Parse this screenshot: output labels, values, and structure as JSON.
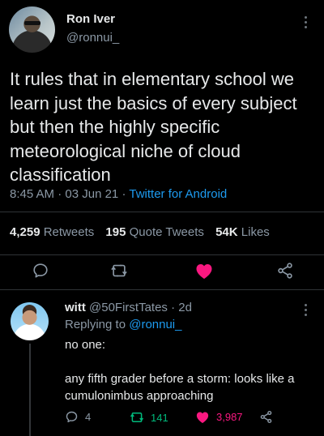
{
  "main_tweet": {
    "display_name": "Ron Iver",
    "handle": "@ronnui_",
    "text": "It rules that in elementary school we learn just the basics of every subject but then the highly specific meteorological niche of cloud classification",
    "time": "8:45 AM",
    "date": "03 Jun 21",
    "client": "Twitter for Android",
    "stats": {
      "retweets_count": "4,259",
      "retweets_label": "Retweets",
      "quotes_count": "195",
      "quotes_label": "Quote Tweets",
      "likes_count": "54K",
      "likes_label": "Likes"
    },
    "actions": [
      "reply",
      "retweet",
      "like",
      "share"
    ],
    "liked": true
  },
  "reply": {
    "display_name": "witt",
    "handle": "@50FirstTates",
    "age": "2d",
    "replying_prefix": "Replying to",
    "replying_to": "@ronnui_",
    "line1": "no one:",
    "line2": "any fifth grader before a storm: looks like a cumulonimbus approaching",
    "reply_count": "4",
    "retweet_count": "141",
    "like_count": "3,987",
    "liked": true
  },
  "colors": {
    "background": "#000000",
    "text": "#e7e9ea",
    "muted": "#8b98a5",
    "link": "#1d9bf0",
    "like": "#f91880",
    "retweet": "#00ba7c"
  }
}
